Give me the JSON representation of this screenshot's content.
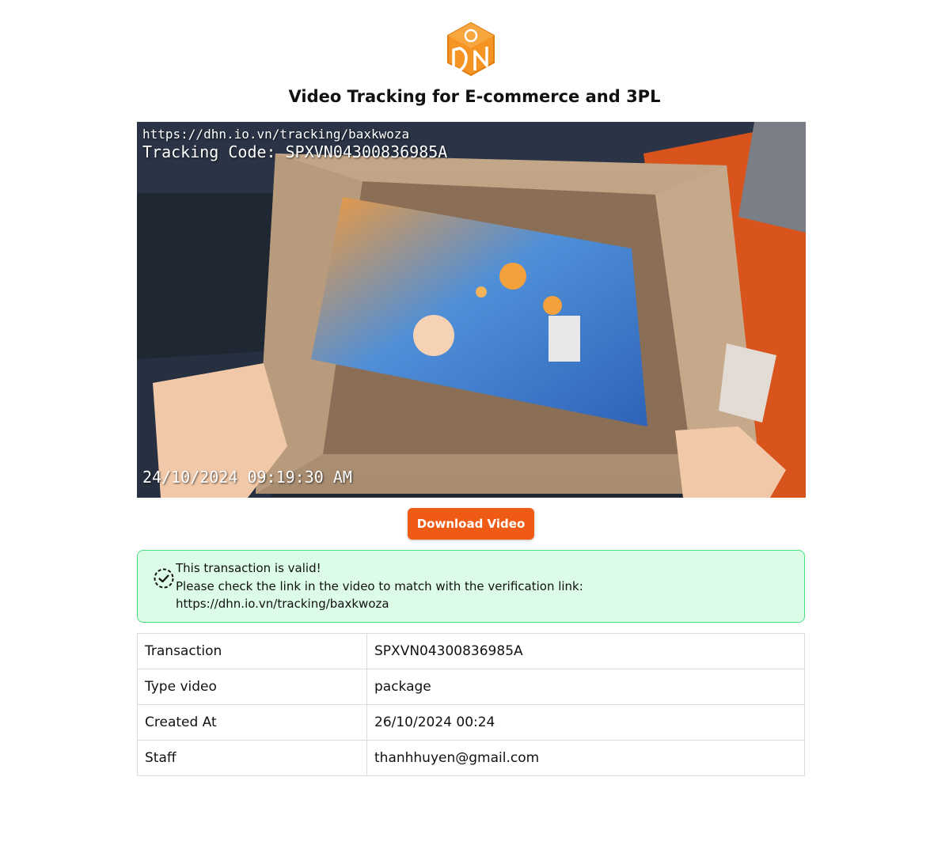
{
  "header": {
    "logo_icon": "dhn-cube-logo-icon",
    "brand_color": "#f59323",
    "title": "Video Tracking for E-commerce and 3PL"
  },
  "video": {
    "overlay_url": "https://dhn.io.vn/tracking/baxkwoza",
    "overlay_code": "Tracking Code: SPXVN04300836985A",
    "overlay_timestamp": "24/10/2024 09:19:30 AM"
  },
  "download_button": {
    "label": "Download Video",
    "color": "#ef5a14"
  },
  "alert": {
    "icon": "verified-check-icon",
    "title": "This transaction is valid!",
    "message": "Please check the link in the video to match with the verification link:",
    "link": "https://dhn.io.vn/tracking/baxkwoza",
    "background": "#dcfce7",
    "border_color": "#4ade80"
  },
  "details": {
    "rows": [
      {
        "label": "Transaction",
        "value": "SPXVN04300836985A"
      },
      {
        "label": "Type video",
        "value": "package"
      },
      {
        "label": "Created At",
        "value": "26/10/2024 00:24"
      },
      {
        "label": "Staff",
        "value": "thanhhuyen@gmail.com"
      }
    ]
  }
}
